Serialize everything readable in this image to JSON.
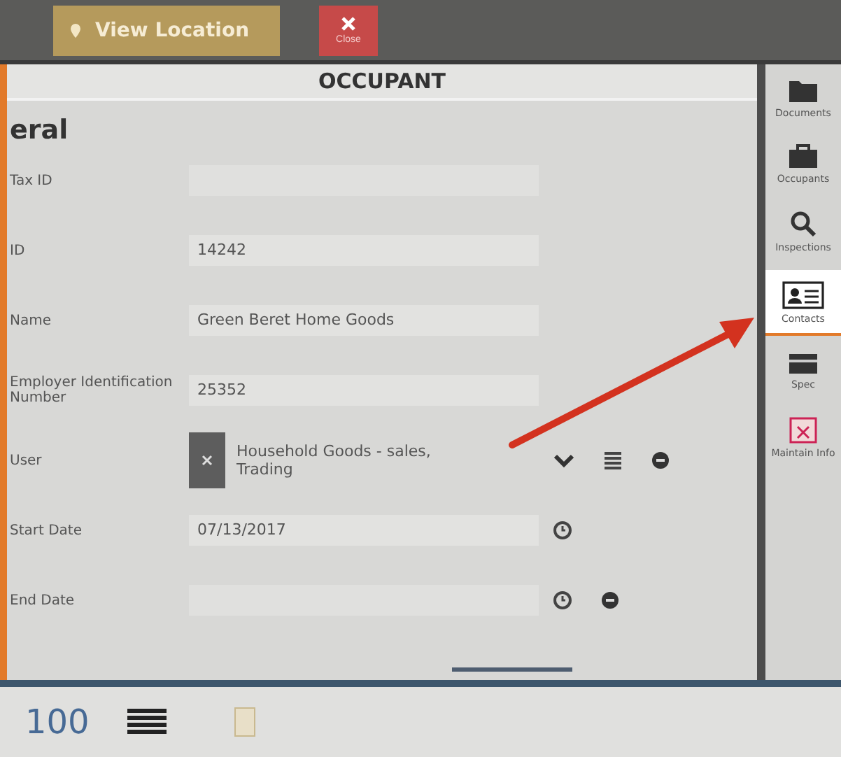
{
  "toolbar": {
    "buttons": [
      {
        "kind": "view",
        "label": "View Location"
      },
      {
        "kind": "close",
        "label": "Close"
      }
    ]
  },
  "panel": {
    "title": "OCCUPANT",
    "section": "eral",
    "fields": [
      {
        "kind": "text",
        "label": "Tax ID",
        "removable": false
      },
      {
        "kind": "text",
        "label": "ID",
        "value": "14242",
        "removable": false
      },
      {
        "kind": "text",
        "label": "Name",
        "value": "Green Beret Home Goods",
        "removable": false
      },
      {
        "kind": "text",
        "label": "Employer Identification Number",
        "value": "25352",
        "removable": false
      },
      {
        "kind": "tag",
        "label": "User",
        "value": "Household Goods - sales, Trading",
        "removable": true
      },
      {
        "kind": "date",
        "label": "Start Date",
        "value": "07/13/2017",
        "removable": false
      },
      {
        "kind": "date",
        "label": "End Date",
        "removable": true
      }
    ]
  },
  "sidebar": {
    "items": [
      {
        "label": "Documents",
        "selected": false
      },
      {
        "label": "Occupants",
        "selected": false
      },
      {
        "label": "Inspections",
        "selected": false
      },
      {
        "label": "Contacts",
        "selected": true
      },
      {
        "label": "Spec",
        "selected": false
      },
      {
        "label": "Maintain Info",
        "selected": false
      }
    ]
  },
  "footer": {
    "count": "100"
  }
}
